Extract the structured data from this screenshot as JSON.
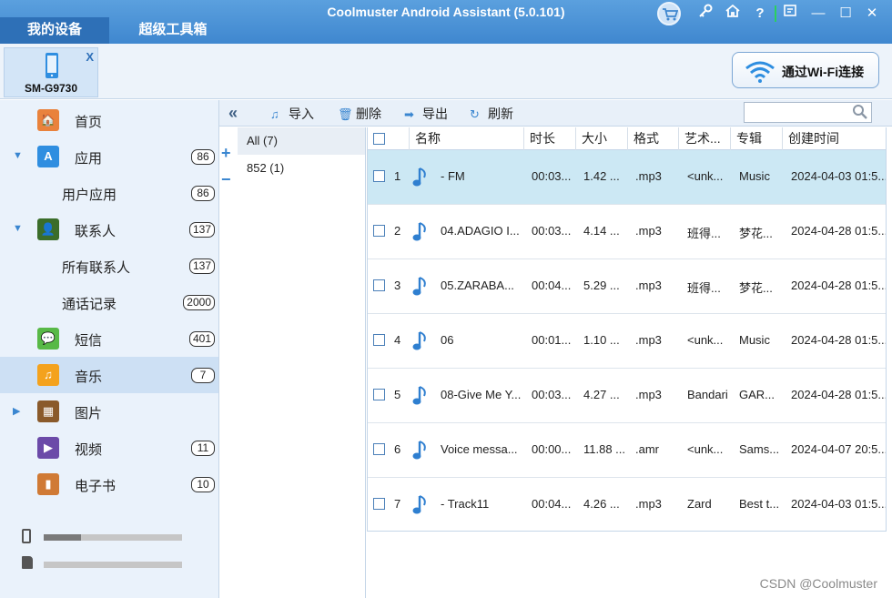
{
  "window": {
    "title": "Coolmuster Android Assistant (5.0.101)",
    "tabs": [
      {
        "label": "我的设备",
        "active": true
      },
      {
        "label": "超级工具箱",
        "active": false
      }
    ],
    "controls": {
      "key": "🔑",
      "home": "⌂",
      "help": "?",
      "minimize": "—",
      "maximize": "☐",
      "close": "✕"
    }
  },
  "device": {
    "name": "SM-G9730",
    "close_label": "X"
  },
  "wifi_button": {
    "label": "通过Wi-Fi连接"
  },
  "sidebar": {
    "items": [
      {
        "label": "首页",
        "count": null,
        "arrow": "",
        "sub": false,
        "icon": "home-icon",
        "color": "#e9823c"
      },
      {
        "label": "应用",
        "count": "86",
        "arrow": "▼",
        "sub": false,
        "icon": "apps-icon",
        "color": "#2f8ee0"
      },
      {
        "label": "用户应用",
        "count": "86",
        "arrow": "",
        "sub": true,
        "icon": "",
        "color": ""
      },
      {
        "label": "联系人",
        "count": "137",
        "arrow": "▼",
        "sub": false,
        "icon": "contacts-icon",
        "color": "#3b6d2a"
      },
      {
        "label": "所有联系人",
        "count": "137",
        "arrow": "",
        "sub": true,
        "icon": "",
        "color": ""
      },
      {
        "label": "通话记录",
        "count": "2000",
        "arrow": "",
        "sub": true,
        "icon": "",
        "color": ""
      },
      {
        "label": "短信",
        "count": "401",
        "arrow": "",
        "sub": false,
        "icon": "sms-icon",
        "color": "#58b947"
      },
      {
        "label": "音乐",
        "count": "7",
        "arrow": "",
        "sub": false,
        "icon": "music-icon",
        "color": "#f4a21d",
        "selected": true
      },
      {
        "label": "图片",
        "count": null,
        "arrow": "▶",
        "sub": false,
        "icon": "photos-icon",
        "color": "#8a5a2b"
      },
      {
        "label": "视频",
        "count": "11",
        "arrow": "",
        "sub": false,
        "icon": "video-icon",
        "color": "#6b4aa8"
      },
      {
        "label": "电子书",
        "count": "10",
        "arrow": "",
        "sub": false,
        "icon": "ebook-icon",
        "color": "#d07a35"
      }
    ],
    "storage": [
      {
        "type": "phone-storage-icon",
        "used_fraction": 0.27
      },
      {
        "type": "sd-card-icon",
        "used_fraction": 0.0
      }
    ]
  },
  "toolbar": {
    "collapse": "«",
    "import": "导入",
    "delete": "删除",
    "export": "导出",
    "refresh": "刷新",
    "search_value": ""
  },
  "albums": {
    "items": [
      {
        "label": "All (7)",
        "active": true
      },
      {
        "label": "852 (1)",
        "active": false
      }
    ]
  },
  "table": {
    "headers": [
      "名称",
      "时长",
      "大小",
      "格式",
      "艺术...",
      "专辑",
      "创建时间"
    ],
    "rows": [
      {
        "index": "1",
        "name": "-   FM",
        "duration": "00:03...",
        "size": "1.42 ...",
        "format": ".mp3",
        "artist": "<unk...",
        "album": "Music",
        "created": "2024-04-03 01:5...",
        "selected": true
      },
      {
        "index": "2",
        "name": "04.ADAGIO I...",
        "duration": "00:03...",
        "size": "4.14 ...",
        "format": ".mp3",
        "artist": "班得...",
        "album": "梦花...",
        "created": "2024-04-28 01:5..."
      },
      {
        "index": "3",
        "name": "05.ZARABA...",
        "duration": "00:04...",
        "size": "5.29 ...",
        "format": ".mp3",
        "artist": "班得...",
        "album": "梦花...",
        "created": "2024-04-28 01:5..."
      },
      {
        "index": "4",
        "name": "06",
        "duration": "00:01...",
        "size": "1.10 ...",
        "format": ".mp3",
        "artist": "<unk...",
        "album": "Music",
        "created": "2024-04-28 01:5..."
      },
      {
        "index": "5",
        "name": "08-Give Me Y...",
        "duration": "00:03...",
        "size": "4.27 ...",
        "format": ".mp3",
        "artist": "Bandari",
        "album": "GAR...",
        "created": "2024-04-28 01:5..."
      },
      {
        "index": "6",
        "name": "Voice messa...",
        "duration": "00:00...",
        "size": "11.88 ...",
        "format": ".amr",
        "artist": "<unk...",
        "album": "Sams...",
        "created": "2024-04-07 20:5..."
      },
      {
        "index": "7",
        "name": "- Track11",
        "duration": "00:04...",
        "size": "4.26 ...",
        "format": ".mp3",
        "artist": "Zard",
        "album": "Best t...",
        "created": "2024-04-03 01:5..."
      }
    ]
  },
  "watermark": "CSDN @Coolmuster"
}
